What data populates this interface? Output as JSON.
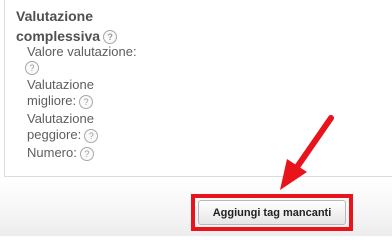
{
  "rating_panel": {
    "title_line1": "Valutazione",
    "title_line2": "complessiva",
    "help_glyph": "?",
    "fields": [
      {
        "label": "Valore valutazione:"
      },
      {
        "label_line1": "Valutazione",
        "label_line2": "migliore:"
      },
      {
        "label_line1": "Valutazione",
        "label_line2": "peggiore:"
      },
      {
        "label": "Numero:"
      }
    ]
  },
  "footer": {
    "add_missing_tags_label": "Aggiungi tag mancanti"
  },
  "annotation": {
    "arrow_color": "#e8131b",
    "highlight_color": "#e8131b"
  },
  "icons": {
    "help": "help-icon",
    "arrow": "red-arrow-annotation"
  }
}
